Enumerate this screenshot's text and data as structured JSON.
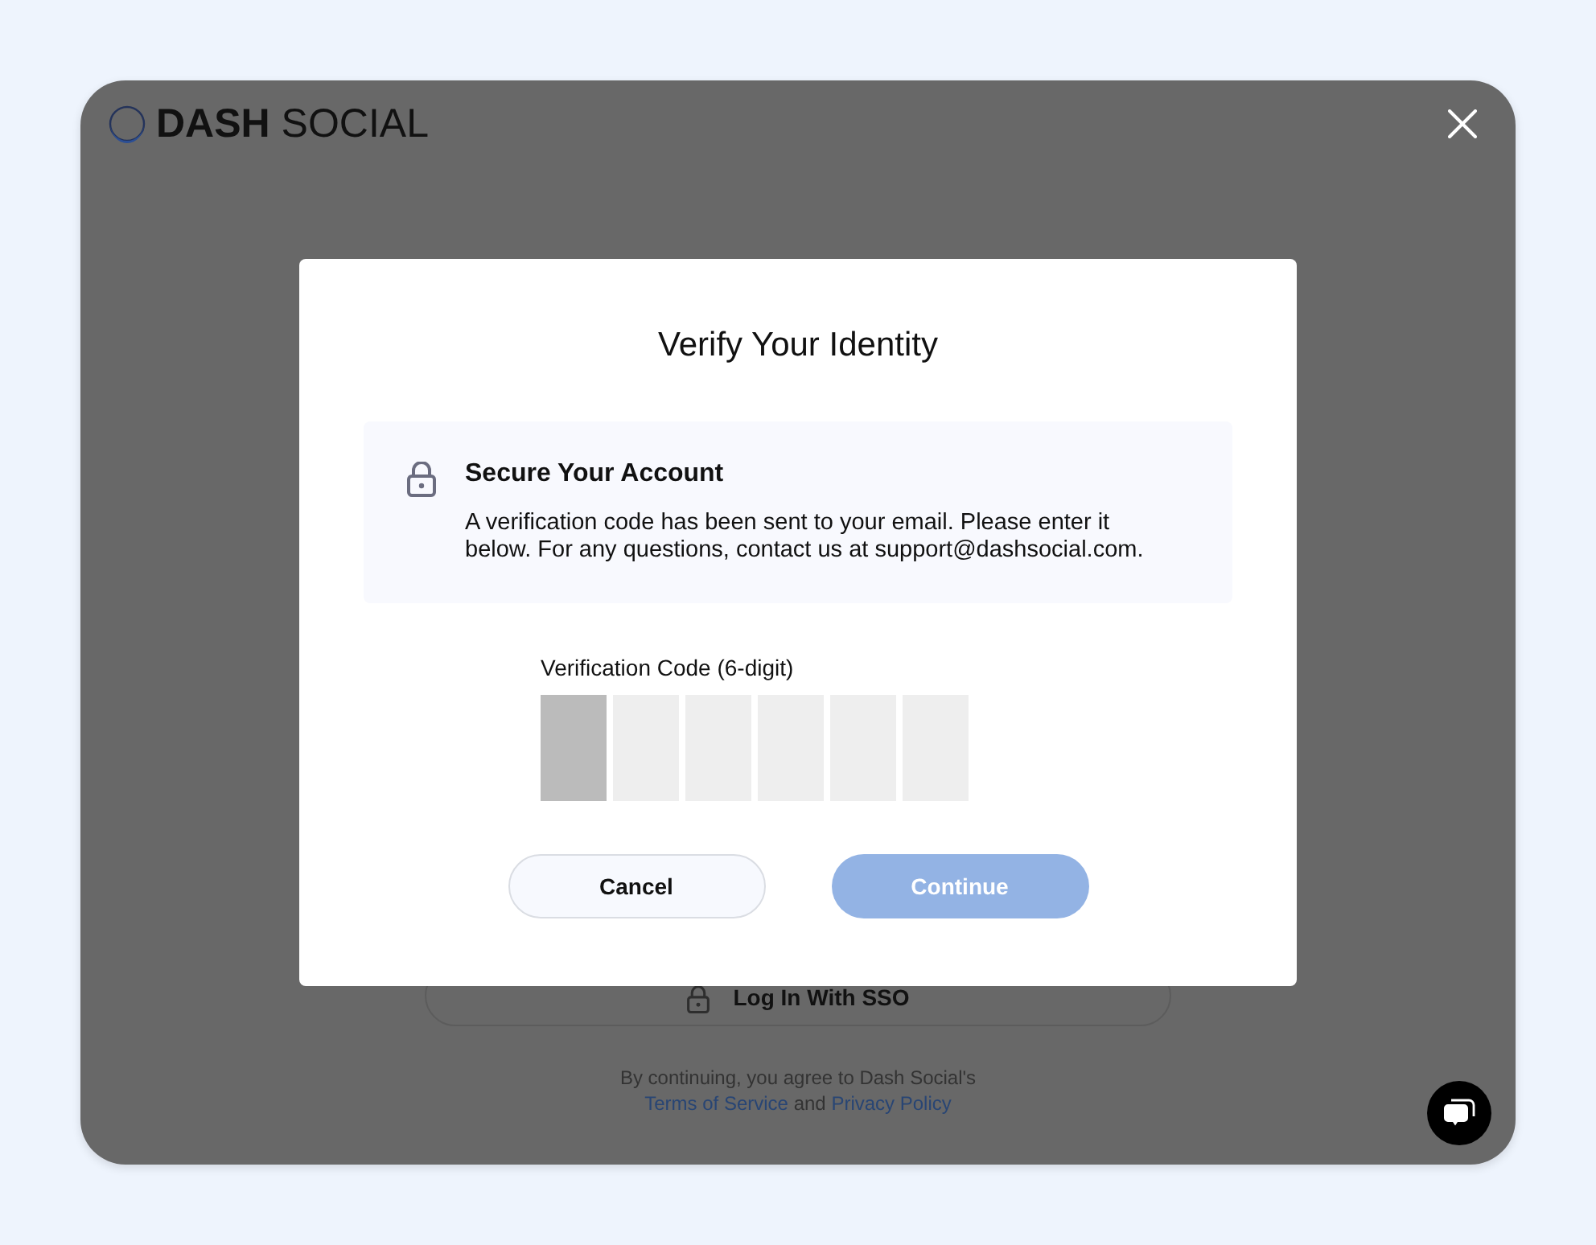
{
  "background": {
    "logo": {
      "wordmark": "**DASH** SOCIAL"
    },
    "sso_button": {
      "label": "Log In With SSO"
    },
    "legal_notice": {
      "text": "By continuing, you agree to Dash Social's",
      "terms_link": "Terms of Service",
      "joiner": "and",
      "privacy_link": "Privacy Policy"
    }
  },
  "dialog": {
    "title": "Verify Your Identity",
    "notice": {
      "heading": "Secure Your Account",
      "body": "A verification code has been sent to your email. Please enter it below. For any questions, contact us at support@dashsocial.com."
    },
    "code": {
      "label": "Verification Code (6-digit)",
      "digits": [
        {
          "focused": true
        },
        {
          "focused": false
        },
        {
          "focused": false
        },
        {
          "focused": false
        },
        {
          "focused": false
        },
        {
          "focused": false
        }
      ]
    },
    "buttons": [
      {
        "kind": "secondary",
        "label": "Cancel",
        "disabled": false
      },
      {
        "kind": "primary",
        "label": "Continue",
        "disabled": true
      }
    ]
  }
}
